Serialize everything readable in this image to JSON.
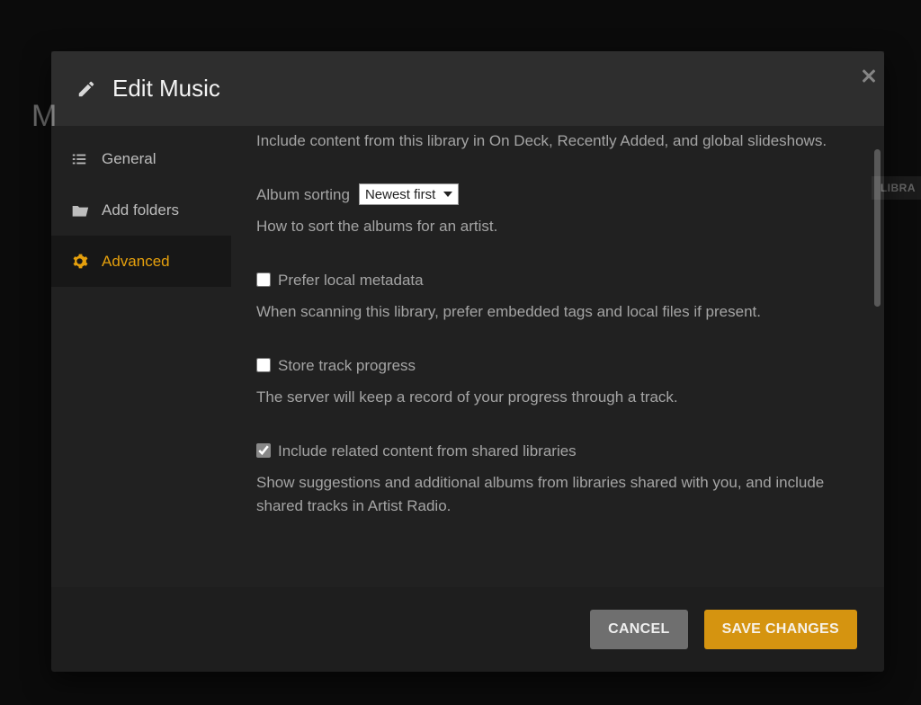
{
  "background": {
    "letter": "M",
    "chip": "LIBRA"
  },
  "modal": {
    "title": "Edit Music",
    "sidebar": {
      "items": [
        {
          "label": "General"
        },
        {
          "label": "Add folders"
        },
        {
          "label": "Advanced"
        }
      ]
    },
    "content": {
      "include_desc": "Include content from this library in On Deck, Recently Added, and global slideshows.",
      "album_sorting_label": "Album sorting",
      "album_sorting_value": "Newest first",
      "album_sorting_help": "How to sort the albums for an artist.",
      "prefer_local_label": "Prefer local metadata",
      "prefer_local_checked": false,
      "prefer_local_help": "When scanning this library, prefer embedded tags and local files if present.",
      "store_progress_label": "Store track progress",
      "store_progress_checked": false,
      "store_progress_help": "The server will keep a record of your progress through a track.",
      "include_related_label": "Include related content from shared libraries",
      "include_related_checked": true,
      "include_related_help": "Show suggestions and additional albums from libraries shared with you, and include shared tracks in Artist Radio."
    },
    "footer": {
      "cancel": "CANCEL",
      "save": "SAVE CHANGES"
    }
  }
}
